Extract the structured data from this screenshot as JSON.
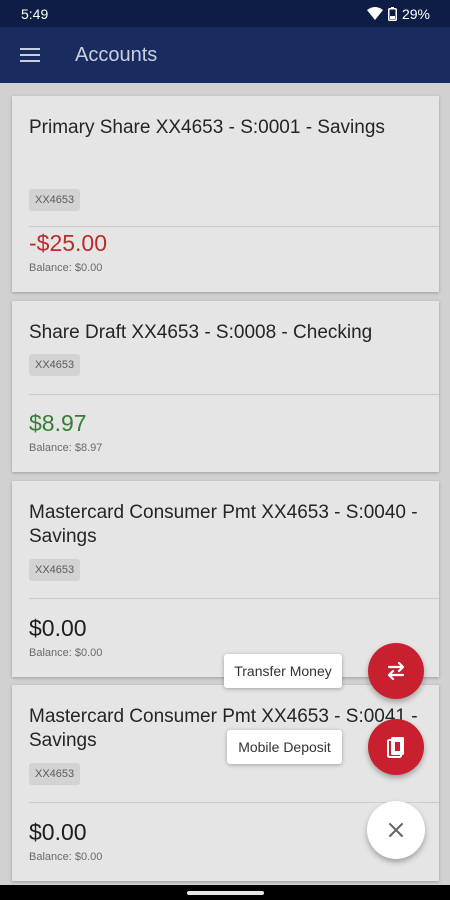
{
  "status_bar": {
    "time": "5:49",
    "battery": "29%"
  },
  "app_bar": {
    "title": "Accounts",
    "menu_icon": "hamburger-menu-icon"
  },
  "accounts": [
    {
      "title": "Primary Share XX4653 - S:0001 - Savings",
      "chip": "XX4653",
      "amount": "-$25.00",
      "amount_color": "#d32f2f",
      "balance": "Balance: $0.00"
    },
    {
      "title": "Share Draft XX4653 - S:0008 - Checking",
      "chip": "XX4653",
      "amount": "$8.97",
      "amount_color": "#388e3c",
      "balance": "Balance: $8.97"
    },
    {
      "title": "Mastercard Consumer Pmt XX4653 - S:0040 - Savings",
      "chip": "XX4653",
      "amount": "$0.00",
      "amount_color": "#222222",
      "balance": "Balance: $0.00"
    },
    {
      "title": "Mastercard Consumer Pmt XX4653 - S:0041 - Savings",
      "chip": "XX4653",
      "amount": "$0.00",
      "amount_color": "#222222",
      "balance": "Balance: $0.00"
    }
  ],
  "fab_menu": {
    "transfer_label": "Transfer Money",
    "deposit_label": "Mobile Deposit",
    "accent_color": "#c8202f"
  }
}
